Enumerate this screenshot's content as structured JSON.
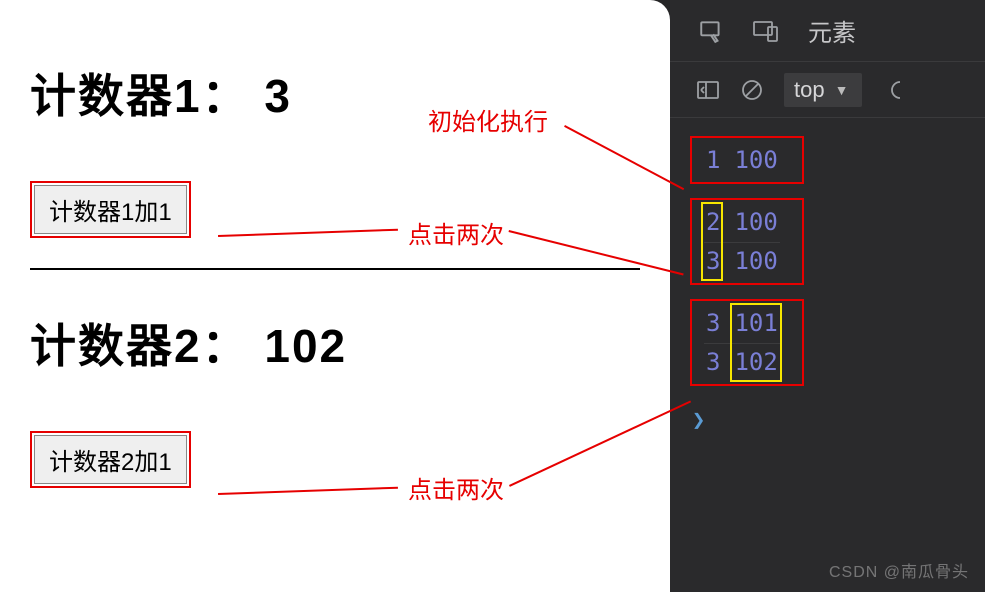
{
  "counters": {
    "c1": {
      "label_prefix": "计数器1：",
      "value": "3",
      "button_label": "计数器1加1"
    },
    "c2": {
      "label_prefix": "计数器2：",
      "value": "102",
      "button_label": "计数器2加1"
    }
  },
  "annotations": {
    "init": "初始化执行",
    "click_twice_1": "点击两次",
    "click_twice_2": "点击两次"
  },
  "devtools": {
    "tab_elements": "元素",
    "context": "top",
    "logs": {
      "group1": [
        {
          "a": "1",
          "b": "100"
        }
      ],
      "group2": [
        {
          "a": "2",
          "b": "100"
        },
        {
          "a": "3",
          "b": "100"
        }
      ],
      "group3": [
        {
          "a": "3",
          "b": "101"
        },
        {
          "a": "3",
          "b": "102"
        }
      ]
    }
  },
  "watermark": "CSDN @南瓜骨头"
}
